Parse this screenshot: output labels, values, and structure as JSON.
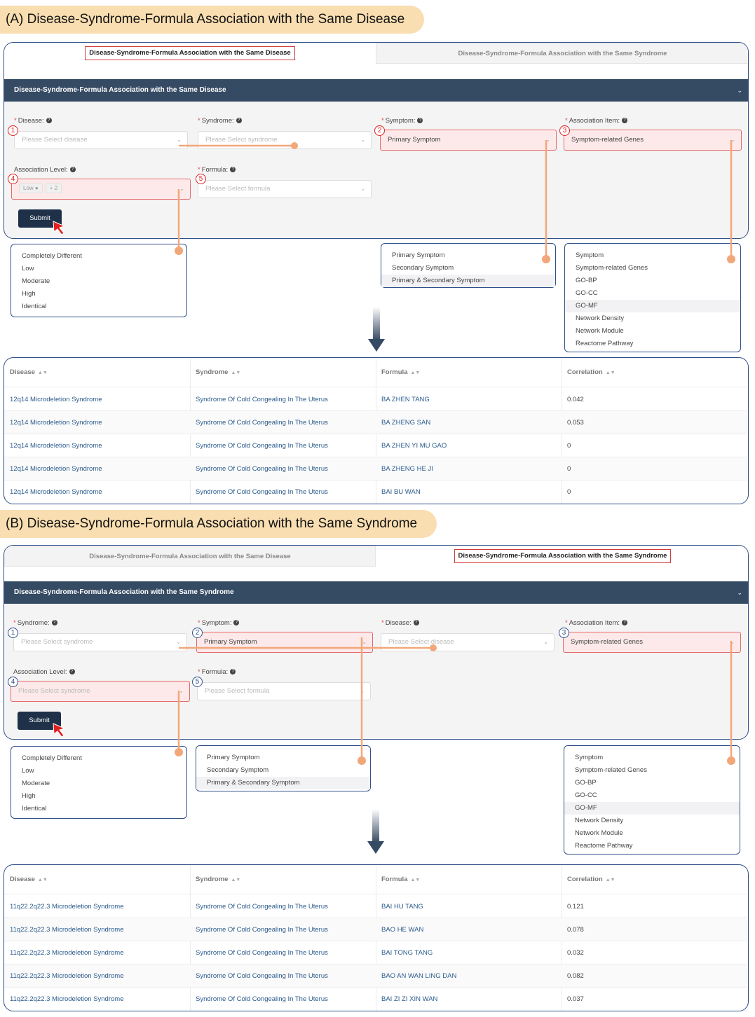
{
  "colors": {
    "header": "#354a63",
    "highlight": "#e36a6a",
    "connector": "#f2a77a",
    "border": "#2f4f8a",
    "link": "#2a5a8c"
  },
  "sectionA": {
    "title": "(A) Disease-Syndrome-Formula Association with the Same Disease",
    "tabs": [
      "Disease-Syndrome-Formula Association with the Same Disease",
      "Disease-Syndrome-Formula Association with the Same Syndrome"
    ],
    "active_tab": 0,
    "header": "Disease-Syndrome-Formula Association with the Same Disease",
    "fields": {
      "f1": {
        "label": "Disease:",
        "placeholder": "Please Select disease",
        "badge": "1"
      },
      "f2": {
        "label": "Syndrome:",
        "placeholder": "Please Select syndrome"
      },
      "f3": {
        "label": "Symptom:",
        "value": "Primary Symptom",
        "badge": "2"
      },
      "f4": {
        "label": "Association Item:",
        "value": "Symptom-related Genes",
        "badge": "3"
      },
      "f5": {
        "label": "Association Level:",
        "tag": "Low",
        "more": "+ 2",
        "badge": "4"
      },
      "f6": {
        "label": "Formula:",
        "placeholder": "Please Select formula",
        "badge": "5"
      }
    },
    "submit": "Submit",
    "dropdowns": {
      "level": [
        "Completely Different",
        "Low",
        "Moderate",
        "High",
        "Identical"
      ],
      "symptom": [
        "Primary Symptom",
        "Secondary Symptom",
        "Primary & Secondary Symptom"
      ],
      "item": [
        "Symptom",
        "Symptom-related Genes",
        "GO-BP",
        "GO-CC",
        "GO-MF",
        "Network Density",
        "Network Module",
        "Reactome Pathway"
      ]
    },
    "table": {
      "columns": [
        "Disease",
        "Syndrome",
        "Formula",
        "Correlation"
      ],
      "rows": [
        [
          "12q14 Microdeletion Syndrome",
          "Syndrome Of Cold Congealing In The Uterus",
          "BA ZHEN TANG",
          "0.042"
        ],
        [
          "12q14 Microdeletion Syndrome",
          "Syndrome Of Cold Congealing In The Uterus",
          "BA ZHENG SAN",
          "0.053"
        ],
        [
          "12q14 Microdeletion Syndrome",
          "Syndrome Of Cold Congealing In The Uterus",
          "BA ZHEN YI MU GAO",
          "0"
        ],
        [
          "12q14 Microdeletion Syndrome",
          "Syndrome Of Cold Congealing In The Uterus",
          "BA ZHENG HE JI",
          "0"
        ],
        [
          "12q14 Microdeletion Syndrome",
          "Syndrome Of Cold Congealing In The Uterus",
          "BAI BU WAN",
          "0"
        ]
      ]
    }
  },
  "sectionB": {
    "title": "(B) Disease-Syndrome-Formula Association with the Same Syndrome",
    "tabs": [
      "Disease-Syndrome-Formula Association with the Same Disease",
      "Disease-Syndrome-Formula Association with the Same Syndrome"
    ],
    "active_tab": 1,
    "header": "Disease-Syndrome-Formula Association with the Same Syndrome",
    "fields": {
      "f1": {
        "label": "Syndrome:",
        "placeholder": "Please Select syndrome",
        "badge": "1"
      },
      "f2": {
        "label": "Symptom:",
        "value": "Primary Symptom",
        "badge": "2"
      },
      "f3": {
        "label": "Disease:",
        "placeholder": "Please Select disease"
      },
      "f4": {
        "label": "Association Item:",
        "value": "Symptom-related Genes",
        "badge": "3"
      },
      "f5": {
        "label": "Association Level:",
        "placeholder": "Please Select syndrome",
        "badge": "4"
      },
      "f6": {
        "label": "Formula:",
        "placeholder": "Please Select formula",
        "badge": "5"
      }
    },
    "submit": "Submit",
    "dropdowns": {
      "level": [
        "Completely Different",
        "Low",
        "Moderate",
        "High",
        "Identical"
      ],
      "symptom": [
        "Primary Symptom",
        "Secondary Symptom",
        "Primary & Secondary Symptom"
      ],
      "item": [
        "Symptom",
        "Symptom-related Genes",
        "GO-BP",
        "GO-CC",
        "GO-MF",
        "Network Density",
        "Network Module",
        "Reactome Pathway"
      ]
    },
    "table": {
      "columns": [
        "Disease",
        "Syndrome",
        "Formula",
        "Correlation"
      ],
      "rows": [
        [
          "11q22.2q22.3 Microdeletion Syndrome",
          "Syndrome Of Cold Congealing In The Uterus",
          "BAI HU TANG",
          "0.121"
        ],
        [
          "11q22.2q22.3 Microdeletion Syndrome",
          "Syndrome Of Cold Congealing In The Uterus",
          "BAO HE WAN",
          "0.078"
        ],
        [
          "11q22.2q22.3 Microdeletion Syndrome",
          "Syndrome Of Cold Congealing In The Uterus",
          "BAI TONG TANG",
          "0.032"
        ],
        [
          "11q22.2q22.3 Microdeletion Syndrome",
          "Syndrome Of Cold Congealing In The Uterus",
          "BAO AN WAN LING DAN",
          "0.082"
        ],
        [
          "11q22.2q22.3 Microdeletion Syndrome",
          "Syndrome Of Cold Congealing In The Uterus",
          "BAI ZI ZI XIN WAN",
          "0.037"
        ]
      ]
    }
  }
}
